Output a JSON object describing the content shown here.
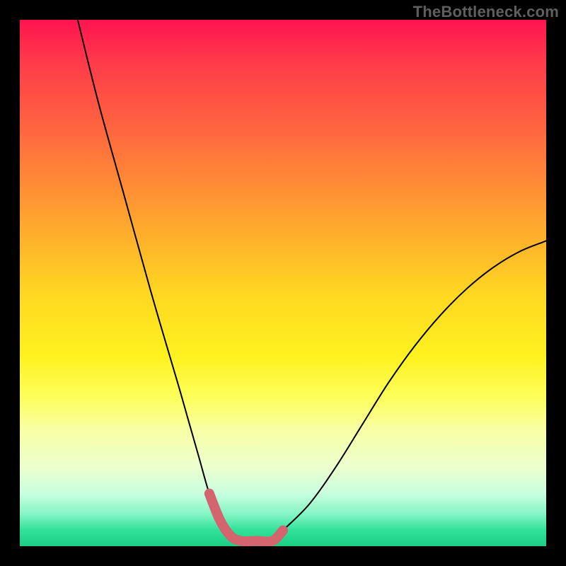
{
  "watermark": "TheBottleneck.com",
  "chart_data": {
    "type": "line",
    "title": "",
    "xlabel": "",
    "ylabel": "",
    "xlim": [
      0,
      100
    ],
    "ylim": [
      0,
      100
    ],
    "series": [
      {
        "name": "bottleneck-curve",
        "x": [
          11,
          15,
          20,
          25,
          30,
          32,
          34,
          36,
          38,
          40,
          42,
          45,
          48,
          50,
          55,
          60,
          65,
          70,
          75,
          80,
          85,
          90,
          95,
          100
        ],
        "values": [
          100,
          84,
          66,
          48,
          31,
          24,
          17,
          10,
          5,
          2,
          1,
          1,
          1,
          3,
          8,
          15,
          23,
          31,
          38,
          44,
          49,
          53,
          56,
          58
        ]
      }
    ],
    "highlight_segment": {
      "name": "flat-bottom",
      "x_start": 36,
      "x_end": 50
    }
  }
}
